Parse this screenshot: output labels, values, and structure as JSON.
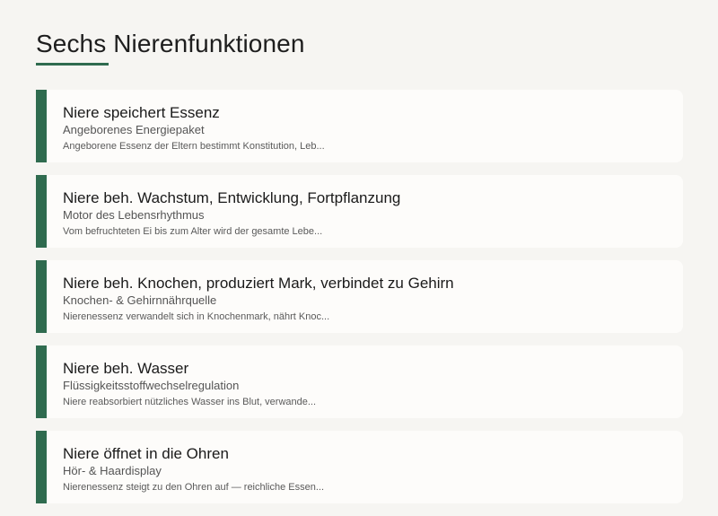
{
  "page": {
    "title": "Sechs Nierenfunktionen"
  },
  "colors": {
    "accent": "#2f6b4f",
    "background": "#f6f5f2",
    "card": "#fdfcfa"
  },
  "cards": [
    {
      "title": "Niere speichert Essenz",
      "subtitle": "Angeborenes Energiepaket",
      "description": "Angeborene Essenz der Eltern bestimmt Konstitution, Leb..."
    },
    {
      "title": "Niere beh. Wachstum, Entwicklung, Fortpflanzung",
      "subtitle": "Motor des Lebensrhythmus",
      "description": "Vom befruchteten Ei bis zum Alter wird der gesamte Lebe..."
    },
    {
      "title": "Niere beh. Knochen, produziert Mark, verbindet zu Gehirn",
      "subtitle": "Knochen- & Gehirnnährquelle",
      "description": "Nierenessenz verwandelt sich in Knochenmark, nährt Knoc..."
    },
    {
      "title": "Niere beh. Wasser",
      "subtitle": "Flüssigkeitsstoffwechselregulation",
      "description": "Niere reabsorbiert nützliches Wasser ins Blut, verwande..."
    },
    {
      "title": "Niere öffnet in die Ohren",
      "subtitle": "Hör- & Haardisplay",
      "description": "Nierenessenz steigt zu den Ohren auf — reichliche Essen..."
    }
  ]
}
